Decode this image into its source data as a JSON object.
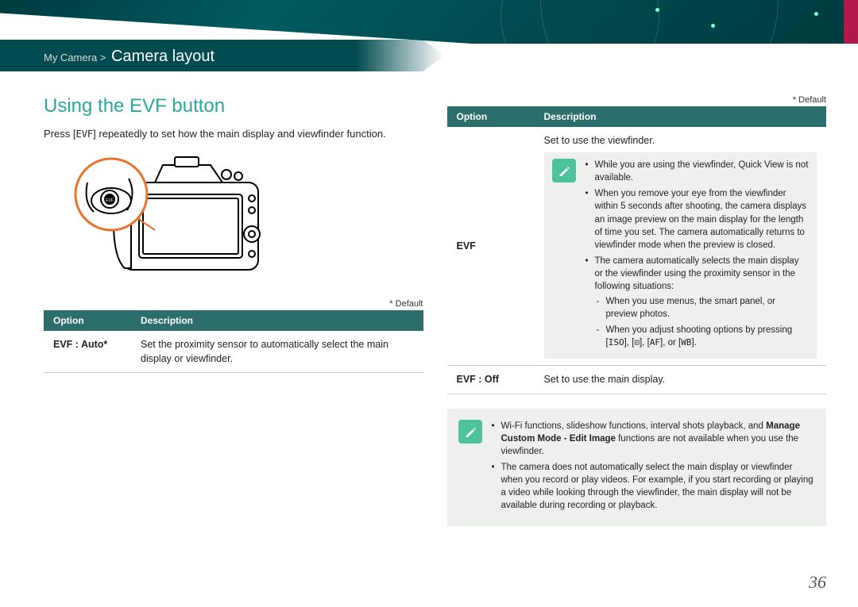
{
  "breadcrumb": {
    "parent": "My Camera >",
    "current": "Camera layout"
  },
  "section_title": "Using the EVF button",
  "intro_prefix": "Press [",
  "intro_button": "EVF",
  "intro_suffix": "] repeatedly to set how the main display and viewfinder function.",
  "default_label": "* Default",
  "table_headers": {
    "option": "Option",
    "description": "Description"
  },
  "left_table": {
    "row1": {
      "option": "EVF : Auto*",
      "desc": "Set the proximity sensor to automatically select the main display or viewfinder."
    }
  },
  "right_table": {
    "row1": {
      "option": "EVF",
      "summary": "Set to use the viewfinder.",
      "notes": {
        "b1": "While you are using the viewfinder, Quick View is not available.",
        "b2": "When you remove your eye from the viewfinder within 5 seconds after shooting, the camera displays an image preview on the main display for the length of time you set. The camera automatically returns to viewfinder mode when the preview is closed.",
        "b3": "The camera automatically selects the main display or the viewfinder using the proximity sensor in the following situations:",
        "b3a": "When you use menus, the smart panel, or preview photos.",
        "b3b_pre": "When you adjust shooting options by pressing [",
        "b3b_k1": "ISO",
        "b3b_m1": "], [",
        "b3b_k2": "⊡",
        "b3b_m2": "], [",
        "b3b_k3": "AF",
        "b3b_m3": "], or [",
        "b3b_k4": "WB",
        "b3b_post": "]."
      }
    },
    "row2": {
      "option": "EVF : Off",
      "desc": "Set to use the main display."
    }
  },
  "bottom_note": {
    "b1_pre": "Wi-Fi functions, slideshow functions, interval shots playback, and ",
    "b1_bold": "Manage Custom Mode - Edit Image",
    "b1_post": " functions are not available when you use the viewfinder.",
    "b2": "The camera does not automatically select the main display or viewfinder when you record or play videos. For example, if you start recording or playing a video while looking through the viewfinder, the main display will not be available during recording or playback."
  },
  "page_number": "36"
}
